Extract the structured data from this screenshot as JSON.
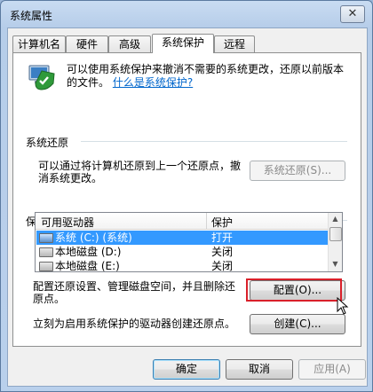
{
  "window": {
    "title": "系统属性",
    "close_glyph": "✕"
  },
  "tabs": [
    {
      "label": "计算机名",
      "active": false
    },
    {
      "label": "硬件",
      "active": false
    },
    {
      "label": "高级",
      "active": false
    },
    {
      "label": "系统保护",
      "active": true
    },
    {
      "label": "远程",
      "active": false
    }
  ],
  "intro": {
    "text": "可以使用系统保护来撤消不需要的系统更改，还原以前版本的文件。",
    "link": "什么是系统保护?"
  },
  "system_restore": {
    "heading": "系统还原",
    "text": "可以通过将计算机还原到上一个还原点，撤消系统更改。",
    "button": "系统还原(S)..."
  },
  "protection": {
    "heading": "保护设置",
    "columns": [
      "可用驱动器",
      "保护"
    ],
    "drives": [
      {
        "name": "系统 (C:) (系统)",
        "protection": "打开",
        "selected": true
      },
      {
        "name": "本地磁盘 (D:)",
        "protection": "关闭",
        "selected": false
      },
      {
        "name": "本地磁盘 (E:)",
        "protection": "关闭",
        "selected": false
      }
    ],
    "config_text": "配置还原设置、管理磁盘空间，并且删除还原点。",
    "config_button": "配置(O)...",
    "create_text": "立刻为启用系统保护的驱动器创建还原点。",
    "create_button": "创建(C)..."
  },
  "footer": {
    "ok": "确定",
    "cancel": "取消",
    "apply": "应用(A)"
  },
  "colors": {
    "highlight_box": "#d9202a",
    "selection": "#3399ff",
    "link": "#0066cc"
  }
}
